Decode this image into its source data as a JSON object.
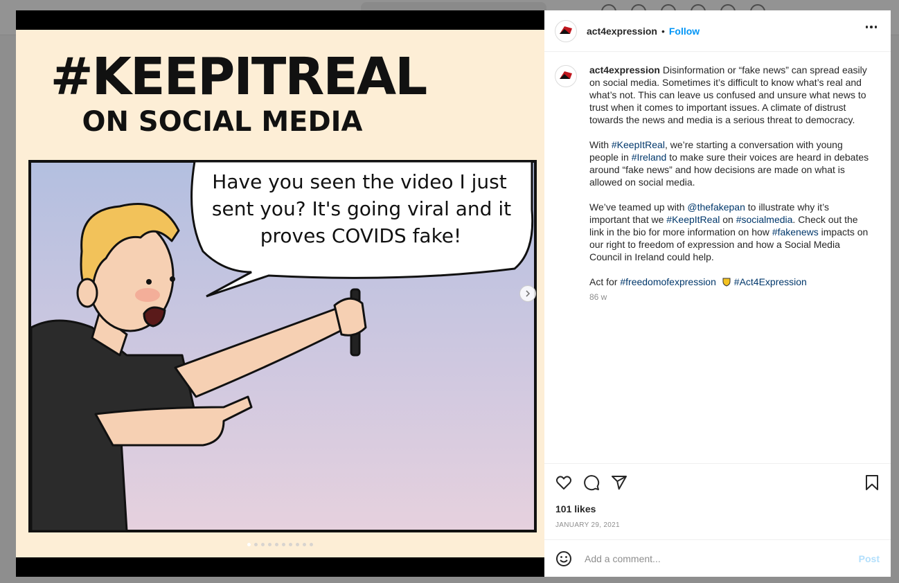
{
  "post": {
    "username": "act4expression",
    "dot": "•",
    "follow_label": "Follow",
    "image": {
      "title_line1": "#KEEPITREAL",
      "title_line2": "ON SOCIAL MEDIA",
      "speech_line1": "Have you seen the video I just",
      "speech_line2": "sent you? It's going viral and it",
      "speech_line3": "proves COVIDS fake!",
      "slide_count": 10,
      "active_slide": 1
    },
    "caption": {
      "p1": "Disinformation or “fake news” can spread easily on social media. Sometimes it’s difficult to know what’s real and what’s not. This can leave us confused and unsure what news to trust when it comes to important issues. A climate of distrust towards the news and media is a serious threat to democracy.",
      "p2_a": "With ",
      "p2_tag1": "#KeepItReal",
      "p2_b": ", we’re starting a conversation with young people in ",
      "p2_tag2": "#Ireland",
      "p2_c": " to make sure their voices are heard in debates around “fake news” and how decisions are made on what is allowed on social media.",
      "p3_a": "We’ve teamed up with ",
      "p3_mention": "@thefakepan",
      "p3_b": " to illustrate why it’s important that we ",
      "p3_tag1": "#KeepItReal",
      "p3_c": " on ",
      "p3_tag2": "#socialmedia",
      "p3_d": ". Check out the link in the bio for more information on how ",
      "p3_tag3": "#fakenews",
      "p3_e": " impacts on our right to freedom of expression and how a Social Media Council in Ireland could help.",
      "p4_a": "Act for ",
      "p4_tag1": "#freedomofexpression",
      "p4_tag2": "#Act4Expression",
      "time": "86 w"
    },
    "likes": "101 likes",
    "date": "JANUARY 29, 2021",
    "comment_placeholder": "Add a comment...",
    "post_label": "Post"
  },
  "colors": {
    "link": "#00376b",
    "follow": "#0095f6",
    "post_disabled": "#b2dffc",
    "art_background": "#fdeed6",
    "sky_top": "#b3bfe0",
    "sky_bottom": "#e6d1de"
  },
  "icons": [
    "heart-icon",
    "comment-icon",
    "share-icon",
    "bookmark-icon",
    "emoji-icon",
    "more-icon",
    "chevron-right-icon",
    "shield-emoji-icon"
  ]
}
